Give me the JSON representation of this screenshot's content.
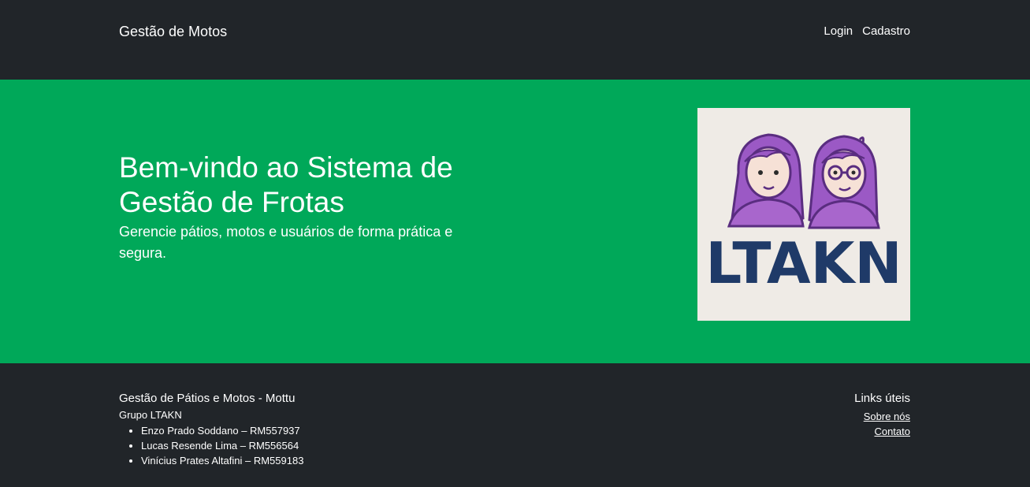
{
  "navbar": {
    "brand": "Gestão de Motos",
    "links": [
      "Login",
      "Cadastro"
    ]
  },
  "hero": {
    "title": "Bem-vindo ao Sistema de Gestão de Frotas",
    "subtitle": "Gerencie pátios, motos e usuários de forma prática e segura.",
    "image": {
      "logo_text": "LTAKN"
    }
  },
  "footer": {
    "title": "Gestão de Pátios e Motos - Mottu",
    "group_name": "Grupo LTAKN",
    "members": [
      "Enzo Prado Soddano – RM557937",
      "Lucas Resende Lima – RM556564",
      "Vinícius Prates Altafini – RM559183"
    ],
    "links_title": "Links úteis",
    "links": [
      "Sobre nós",
      "Contato"
    ]
  },
  "colors": {
    "dark": "#212529",
    "hero_green": "#00a859",
    "logo_bg": "#efebe6",
    "logo_navy": "#1f3a68",
    "hair_purple": "#9b59c5"
  }
}
